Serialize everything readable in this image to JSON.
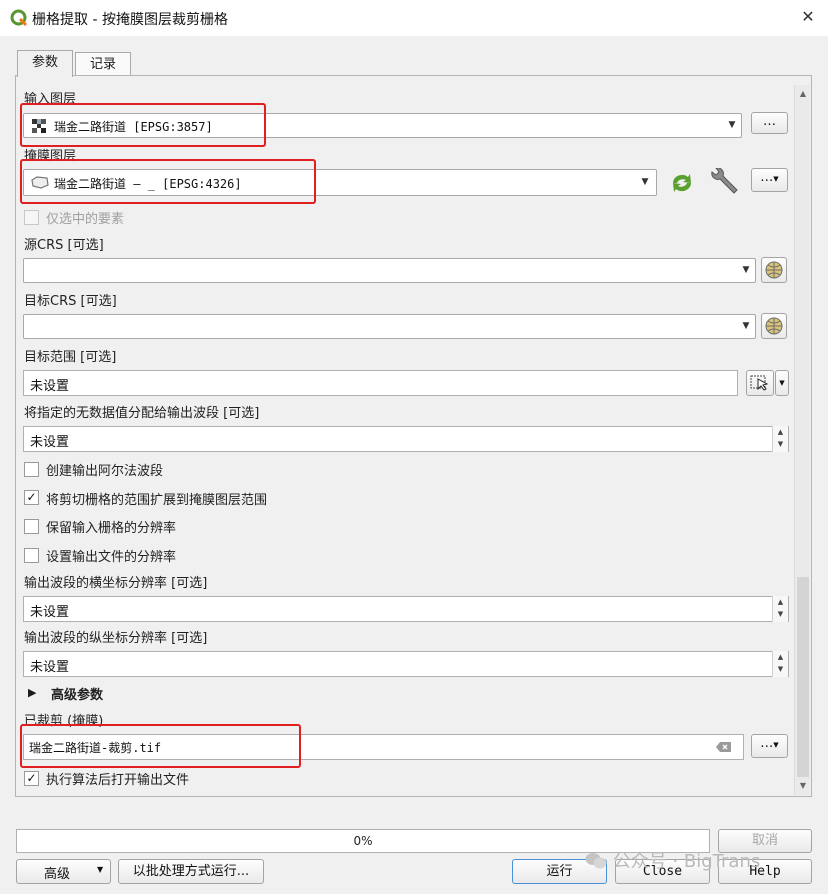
{
  "window": {
    "title": "栅格提取 - 按掩膜图层裁剪栅格",
    "close_label": "✕"
  },
  "tabs": [
    {
      "label": "参数"
    },
    {
      "label": "记录"
    }
  ],
  "fields": {
    "input_layer": {
      "label": "输入图层",
      "value": "瑞金二路街道 [EPSG:3857]"
    },
    "mask_layer": {
      "label": "掩膜图层",
      "value": "瑞金二路街道 — _ [EPSG:4326]"
    },
    "selected_only": {
      "label": "仅选中的要素",
      "checked": false
    },
    "source_crs": {
      "label": "源CRS [可选]",
      "value": ""
    },
    "target_crs": {
      "label": "目标CRS [可选]",
      "value": ""
    },
    "target_extent": {
      "label": "目标范围 [可选]",
      "value": "未设置"
    },
    "nodata": {
      "label": "将指定的无数据值分配给输出波段 [可选]",
      "value": "未设置"
    },
    "create_alpha": {
      "label": "创建输出阿尔法波段",
      "checked": false
    },
    "crop_to_cutline": {
      "label": "将剪切栅格的范围扩展到掩膜图层范围",
      "checked": true
    },
    "keep_resolution": {
      "label": "保留输入栅格的分辨率",
      "checked": false
    },
    "set_resolution": {
      "label": "设置输出文件的分辨率",
      "checked": false
    },
    "x_resolution": {
      "label": "输出波段的横坐标分辨率 [可选]",
      "value": "未设置"
    },
    "y_resolution": {
      "label": "输出波段的纵坐标分辨率 [可选]",
      "value": "未设置"
    },
    "advanced_section": {
      "label": "高级参数"
    },
    "output": {
      "label": "已裁剪 (掩膜)",
      "value": "瑞金二路街道-裁剪.tif"
    },
    "open_output": {
      "label": "执行算法后打开输出文件",
      "checked": true
    }
  },
  "buttons": {
    "ellipsis": "…",
    "cancel": "取消",
    "advanced": "高级",
    "batch": "以批处理方式运行...",
    "run": "运行",
    "close": "Close",
    "help": "Help"
  },
  "progress": {
    "value": 0,
    "label": "0%"
  },
  "watermark": "公众号 · BigTrans",
  "colors": {
    "highlight": "#e02020",
    "qgis_green": "#589632"
  }
}
